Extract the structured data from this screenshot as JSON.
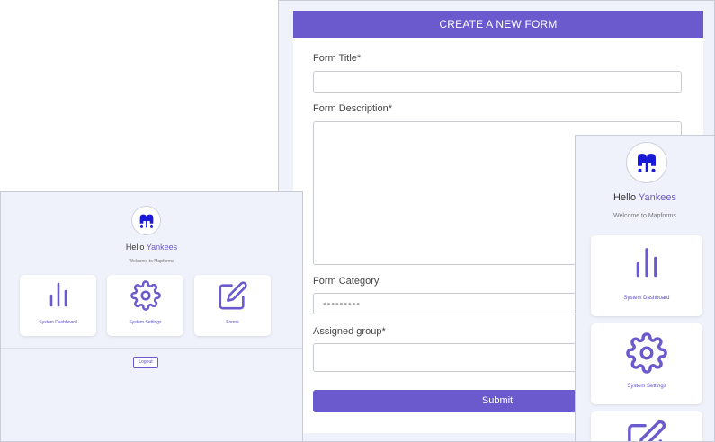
{
  "form": {
    "header": "CREATE A NEW FORM",
    "title_label": "Form Title*",
    "title_value": "",
    "description_label": "Form Description*",
    "description_value": "",
    "category_label": "Form Category",
    "category_value": "---------",
    "group_label": "Assigned group*",
    "group_value": "",
    "submit_label": "Submit"
  },
  "dashboard": {
    "greeting": "Hello",
    "username": "Yankees",
    "welcome": "Welcome to Mapforms",
    "tiles": [
      {
        "label": "System Dashboard",
        "icon": "bar-chart-icon"
      },
      {
        "label": "System Settings",
        "icon": "gear-icon"
      },
      {
        "label": "Forms",
        "icon": "edit-icon"
      }
    ],
    "logout_label": "Logout"
  },
  "colors": {
    "accent": "#6a5acd",
    "background": "#f0f2fb",
    "logo_blue": "#1a1ad6"
  }
}
